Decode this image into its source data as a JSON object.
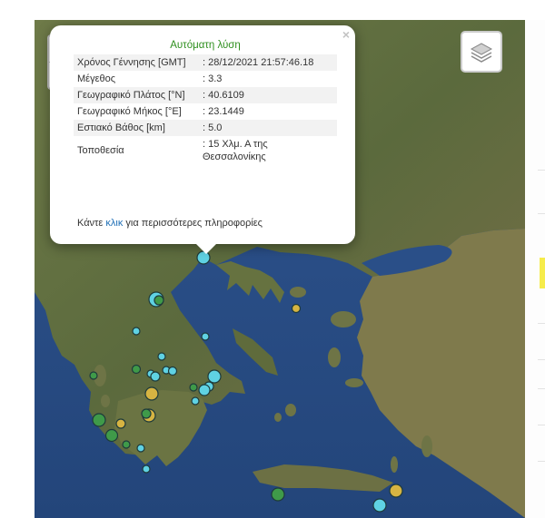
{
  "map": {
    "zoom_in_label": "+",
    "zoom_out_label": "−",
    "layers_icon": "layers-icon",
    "colors": {
      "sea": "#2c4f86",
      "land": "#5c6a3e",
      "quake_cyan": "#5fd2e3",
      "quake_green": "#3f9a49",
      "quake_yellow": "#d6b442"
    }
  },
  "popup": {
    "title": "Αυτόματη λύση",
    "close_label": "×",
    "rows": [
      {
        "label": "Χρόνος Γέννησης [GMT]",
        "value": ": 28/12/2021 21:57:46.18"
      },
      {
        "label": "Μέγεθος",
        "value": ": 3.3"
      },
      {
        "label": "Γεωγραφικό Πλάτος [°N]",
        "value": ": 40.6109"
      },
      {
        "label": "Γεωγραφικό Μήκος [°E]",
        "value": ": 23.1449"
      },
      {
        "label": "Εστιακό Βάθος [km]",
        "value": ": 5.0"
      },
      {
        "label": "Τοποθεσία",
        "value": ": 15 Χλμ. Α της Θεσσαλονίκης"
      }
    ],
    "more_before": "Κάντε ",
    "more_link": "κλικ",
    "more_after": " για περισσότερες πληροφορίες"
  }
}
